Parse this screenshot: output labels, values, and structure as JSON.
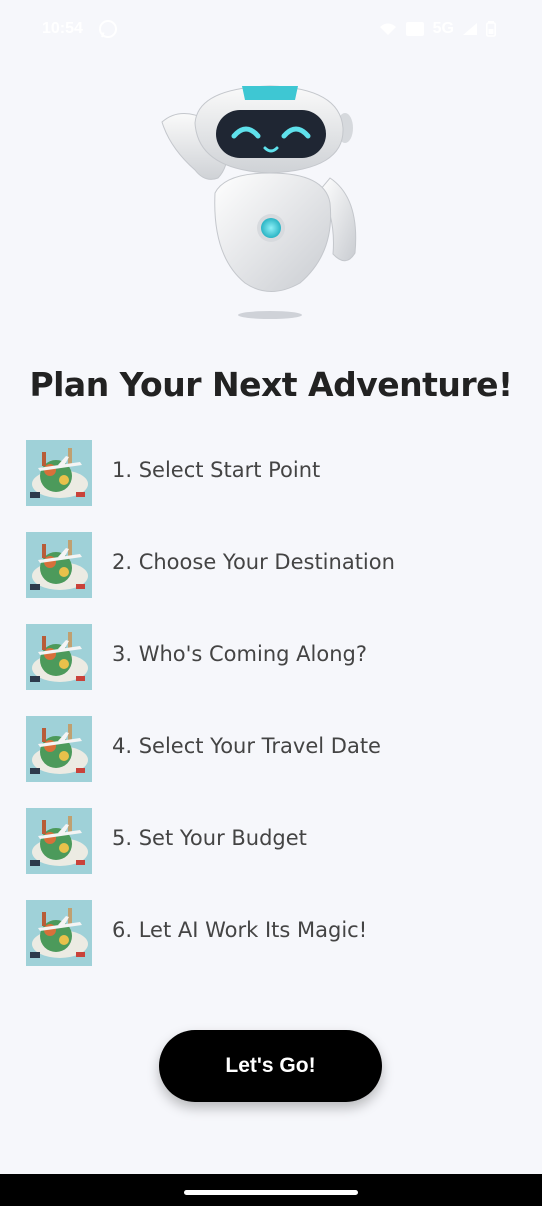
{
  "status_bar": {
    "time": "10:54",
    "network": "5G"
  },
  "title": "Plan Your Next Adventure!",
  "steps": [
    {
      "label": "1. Select Start Point"
    },
    {
      "label": "2. Choose Your Destination"
    },
    {
      "label": "3. Who's Coming Along?"
    },
    {
      "label": "4. Select Your Travel Date"
    },
    {
      "label": "5. Set Your Budget"
    },
    {
      "label": "6. Let AI Work Its Magic!"
    }
  ],
  "cta": {
    "label": "Let's Go!"
  },
  "colors": {
    "accent": "#3ec7d3",
    "button_bg": "#000000",
    "background": "#f6f7fb"
  }
}
